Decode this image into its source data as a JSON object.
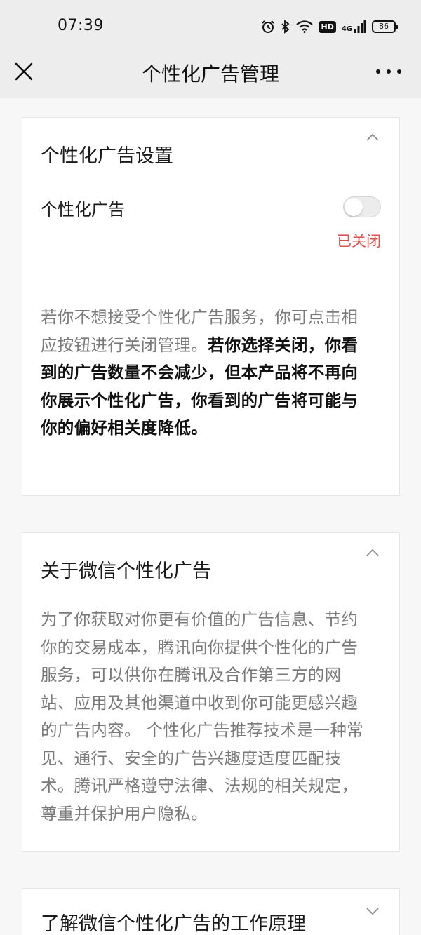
{
  "status_bar": {
    "time": "07:39",
    "network": "4G",
    "hd_badge": "HD",
    "battery": "86"
  },
  "nav": {
    "title": "个性化广告管理"
  },
  "settings_card": {
    "title": "个性化广告设置",
    "row_label": "个性化广告",
    "toggle_on": false,
    "toggle_status": "已关闭",
    "description_normal": "若你不想接受个性化广告服务，你可点击相应按钮进行关闭管理。",
    "description_bold": "若你选择关闭，你看到的广告数量不会减少，但本产品将不再向你展示个性化广告，你看到的广告将可能与你的偏好相关度降低。"
  },
  "about_card": {
    "title": "关于微信个性化广告",
    "body": "为了你获取对你更有价值的广告信息、节约你的交易成本，腾讯向你提供个性化的广告服务，可以供你在腾讯及合作第三方的网站、应用及其他渠道中收到你可能更感兴趣的广告内容。 个性化广告推荐技术是一种常见、通行、安全的广告兴趣度适度匹配技术。腾讯严格遵守法律、法规的相关规定，尊重并保护用户隐私。"
  },
  "principle_card": {
    "title": "了解微信个性化广告的工作原理"
  },
  "colors": {
    "page_bg": "#f7f7f7",
    "header_bg": "#ededed",
    "status_off": "#d9534f",
    "muted_text": "#7a7a7a"
  }
}
